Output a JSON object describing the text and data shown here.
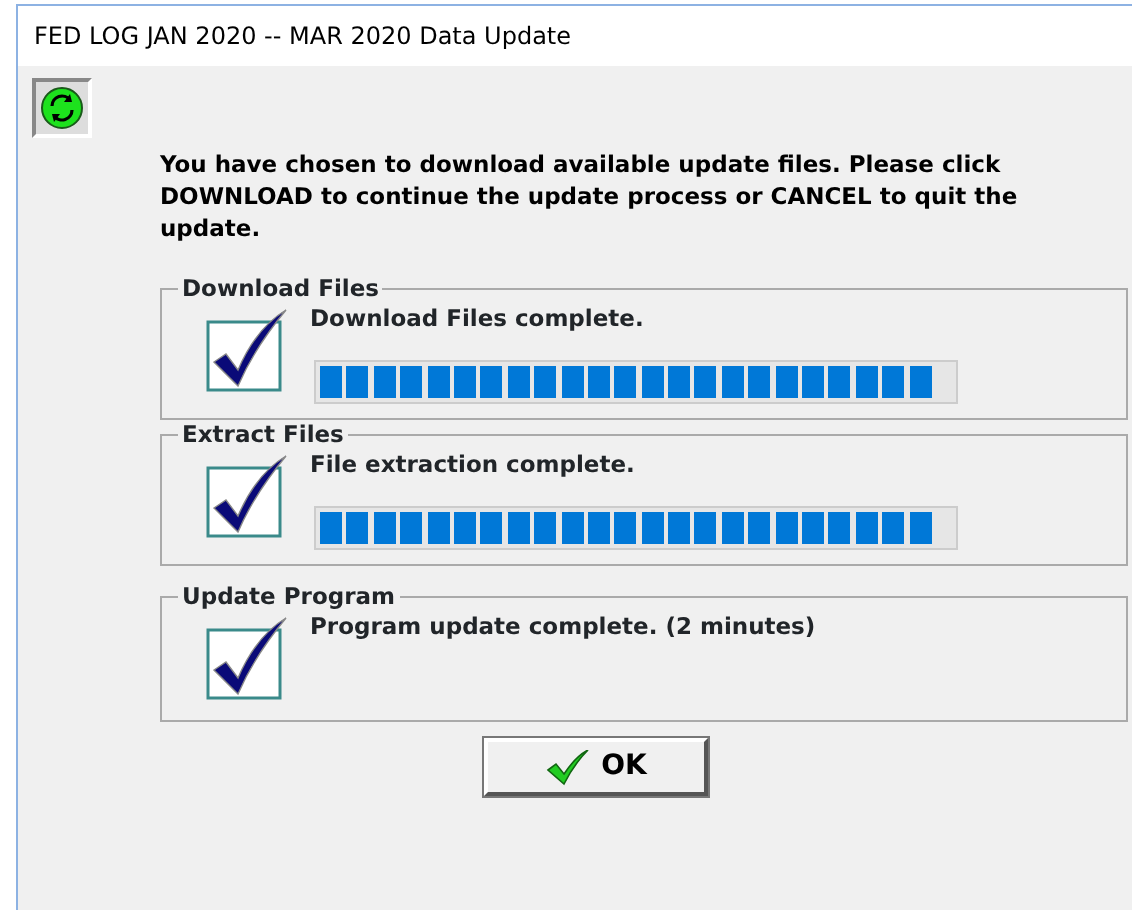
{
  "window": {
    "title": "FED LOG JAN 2020 -- MAR 2020 Data Update"
  },
  "message": "You have chosen to download available update files. Please click DOWNLOAD to continue the update process or CANCEL to quit the update.",
  "steps": [
    {
      "kind": "progress",
      "title": "Download Files",
      "status": "Download Files complete.",
      "done": true,
      "level": 1
    },
    {
      "kind": "progress",
      "title": "Extract Files",
      "status": "File extraction complete.",
      "done": true,
      "level": 1
    },
    {
      "kind": "plain",
      "title": "Update Program",
      "status": "Program update complete. (2 minutes)",
      "done": true
    }
  ],
  "button": {
    "label": "OK"
  }
}
